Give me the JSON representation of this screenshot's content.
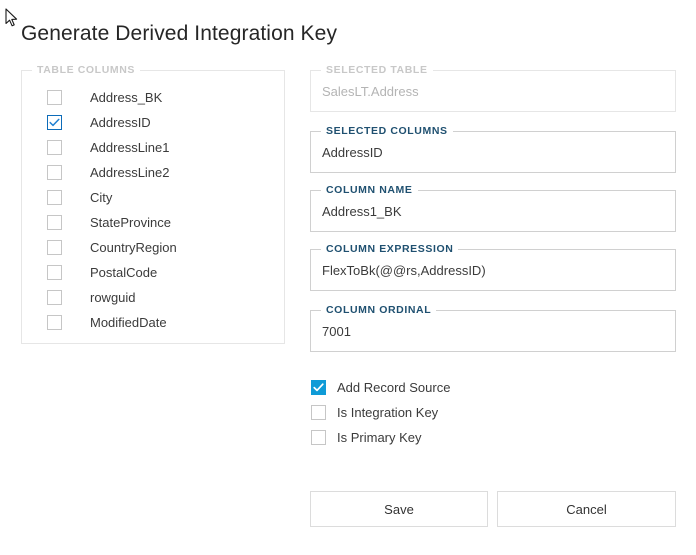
{
  "dialog": {
    "title": "Generate Derived Integration Key"
  },
  "table_columns": {
    "legend": "TABLE COLUMNS",
    "items": [
      {
        "label": "Address_BK",
        "checked": false
      },
      {
        "label": "AddressID",
        "checked": true
      },
      {
        "label": "AddressLine1",
        "checked": false
      },
      {
        "label": "AddressLine2",
        "checked": false
      },
      {
        "label": "City",
        "checked": false
      },
      {
        "label": "StateProvince",
        "checked": false
      },
      {
        "label": "CountryRegion",
        "checked": false
      },
      {
        "label": "PostalCode",
        "checked": false
      },
      {
        "label": "rowguid",
        "checked": false
      },
      {
        "label": "ModifiedDate",
        "checked": false
      }
    ]
  },
  "fields": {
    "selected_table": {
      "legend": "SELECTED TABLE",
      "value": "SalesLT.Address",
      "disabled": true
    },
    "selected_columns": {
      "legend": "SELECTED COLUMNS",
      "value": "AddressID",
      "disabled": false
    },
    "column_name": {
      "legend": "COLUMN NAME",
      "value": "Address1_BK",
      "disabled": false
    },
    "column_expression": {
      "legend": "COLUMN EXPRESSION",
      "value": "FlexToBk(@@rs,AddressID)",
      "disabled": false
    },
    "column_ordinal": {
      "legend": "COLUMN ORDINAL",
      "value": "7001",
      "disabled": false
    }
  },
  "options": [
    {
      "label": "Add Record Source",
      "checked": true
    },
    {
      "label": "Is Integration Key",
      "checked": false
    },
    {
      "label": "Is Primary Key",
      "checked": false
    }
  ],
  "buttons": {
    "save": "Save",
    "cancel": "Cancel"
  },
  "colors": {
    "accent_blue": "#0f9bd7",
    "legend_blue": "#1f5070",
    "outline_blue": "#0d6cb9",
    "border_gray": "#d0d0d0",
    "disabled_gray": "#b4b4b4"
  }
}
